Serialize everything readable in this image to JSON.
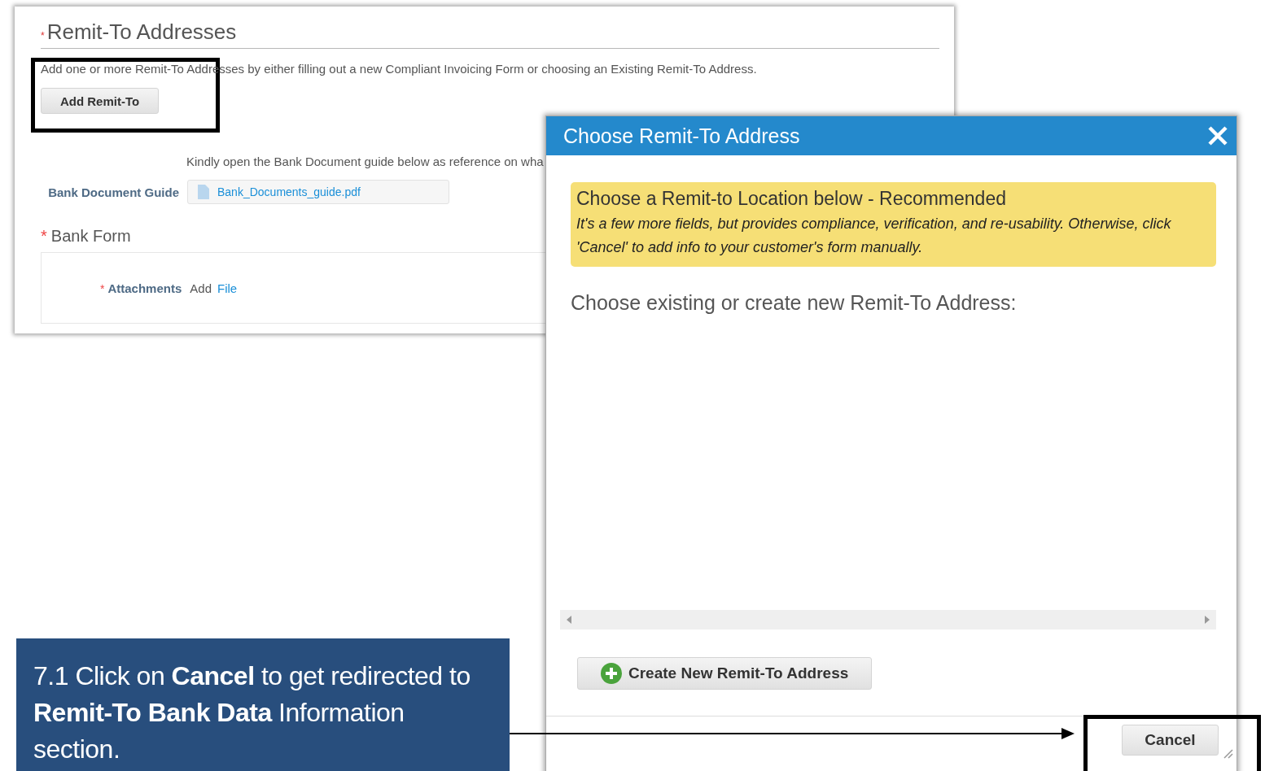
{
  "background_page": {
    "section_title": "Remit-To Addresses",
    "required_mark": "*",
    "description": "Add one or more Remit-To Addresses by either filling out a new Compliant Invoicing Form or choosing an Existing Remit-To Address.",
    "add_button": "Add Remit-To",
    "guide_note": "Kindly open the Bank Document guide below as reference on wha",
    "guide_label": "Bank Document Guide",
    "guide_file": "Bank_Documents_guide.pdf",
    "bank_form": {
      "required_mark": "*",
      "title": "Bank Form",
      "attachments_mark": "*",
      "attachments_label": "Attachments",
      "add_text": "Add",
      "file_link": "File"
    }
  },
  "dialog": {
    "title": "Choose Remit-To Address",
    "notice": {
      "title": "Choose a Remit-to Location below - Recommended",
      "text": "It's a few more fields, but provides compliance, verification, and re-usability. Otherwise, click 'Cancel' to add info to your customer's form manually."
    },
    "prompt": "Choose existing or create new Remit-To Address:",
    "create_button": "Create New Remit-To Address",
    "cancel_button": "Cancel"
  },
  "callout": {
    "text": "7.1 Click on **Cancel** to get redirected to **Remit-To Bank Data** Information section."
  }
}
